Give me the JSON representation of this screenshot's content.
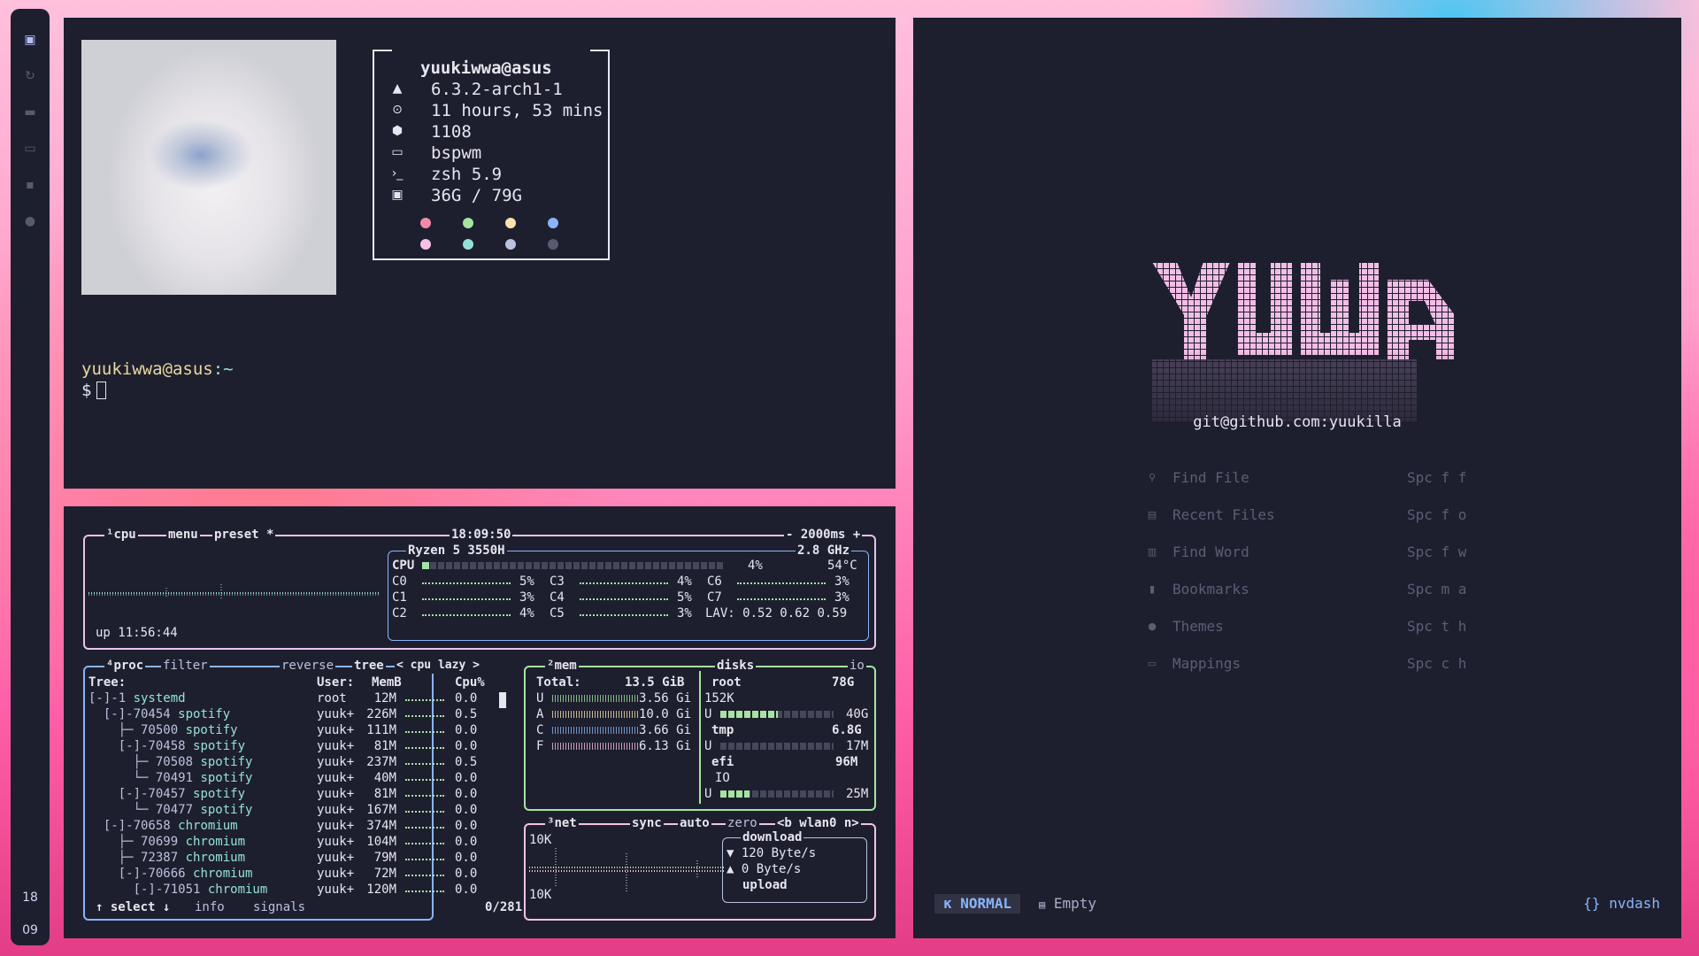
{
  "sidebar": {
    "workspaces": [
      "terminal-icon",
      "refresh-icon",
      "folder-icon",
      "window-icon",
      "chat-icon",
      "music-icon"
    ],
    "clock_hour": "18",
    "clock_minute": "09"
  },
  "neofetch": {
    "header": "yuukiwwa@asus",
    "items": [
      {
        "icon": "arch-icon",
        "glyph": "▲",
        "value": "6.3.2-arch1-1"
      },
      {
        "icon": "uptime-icon",
        "glyph": "⊙",
        "value": "11 hours, 53 mins"
      },
      {
        "icon": "package-icon",
        "glyph": "⬢",
        "value": "1108"
      },
      {
        "icon": "wm-icon",
        "glyph": "▭",
        "value": "bspwm"
      },
      {
        "icon": "shell-icon",
        "glyph": "›_",
        "value": "zsh 5.9"
      },
      {
        "icon": "disk-icon",
        "glyph": "▣",
        "value": "36G / 79G"
      }
    ],
    "colors_row1": [
      "#f38ba8",
      "#a6e3a1",
      "#f9e2af",
      "#89b4fa"
    ],
    "colors_row2": [
      "#f5c2e7",
      "#94e2d5",
      "#bac2de",
      "#585b70"
    ],
    "prompt_user": "yuukiwwa@asus",
    "prompt_path": ":~",
    "prompt_symbol": "$"
  },
  "btop": {
    "cpu": {
      "title": "cpu",
      "menu": "menu",
      "preset": "preset *",
      "clock": "18:09:50",
      "interval": "2000ms",
      "model": "Ryzen 5 3550H",
      "freq": "2.8 GHz",
      "total_label": "CPU",
      "total_pct": "4%",
      "temp": "54°C",
      "uptime": "up 11:56:44",
      "cores": [
        {
          "name": "C0",
          "pct": "5%"
        },
        {
          "name": "C1",
          "pct": "3%"
        },
        {
          "name": "C2",
          "pct": "4%"
        },
        {
          "name": "C3",
          "pct": "4%"
        },
        {
          "name": "C4",
          "pct": "5%"
        },
        {
          "name": "C5",
          "pct": "3%"
        },
        {
          "name": "C6",
          "pct": "3%"
        },
        {
          "name": "C7",
          "pct": "3%"
        }
      ],
      "lav_label": "LAV:",
      "lav": "0.52 0.62 0.59"
    },
    "proc": {
      "title": "proc",
      "filter": "filter",
      "reverse": "reverse",
      "tree": "tree",
      "sort": "< cpu lazy >",
      "headers": {
        "tree": "Tree:",
        "user": "User:",
        "mem": "MemB",
        "cpu": "Cpu%"
      },
      "rows": [
        {
          "prefix": "[-]-1 ",
          "name": "systemd",
          "user": "root",
          "mem": "12M",
          "cpu": "0.0"
        },
        {
          "prefix": "  [-]-70454 ",
          "name": "spotify",
          "user": "yuuk+",
          "mem": "226M",
          "cpu": "0.5"
        },
        {
          "prefix": "    ├─ 70500 ",
          "name": "spotify",
          "user": "yuuk+",
          "mem": "111M",
          "cpu": "0.0"
        },
        {
          "prefix": "    [-]-70458 ",
          "name": "spotify",
          "user": "yuuk+",
          "mem": "81M",
          "cpu": "0.0"
        },
        {
          "prefix": "      ├─ 70508 ",
          "name": "spotify",
          "user": "yuuk+",
          "mem": "237M",
          "cpu": "0.5"
        },
        {
          "prefix": "      └─ 70491 ",
          "name": "spotify",
          "user": "yuuk+",
          "mem": "40M",
          "cpu": "0.0"
        },
        {
          "prefix": "    [-]-70457 ",
          "name": "spotify",
          "user": "yuuk+",
          "mem": "81M",
          "cpu": "0.0"
        },
        {
          "prefix": "      └─ 70477 ",
          "name": "spotify",
          "user": "yuuk+",
          "mem": "167M",
          "cpu": "0.0"
        },
        {
          "prefix": "  [-]-70658 ",
          "name": "chromium",
          "user": "yuuk+",
          "mem": "374M",
          "cpu": "0.0"
        },
        {
          "prefix": "    ├─ 70699 ",
          "name": "chromium",
          "user": "yuuk+",
          "mem": "104M",
          "cpu": "0.0"
        },
        {
          "prefix": "    ├─ 72387 ",
          "name": "chromium",
          "user": "yuuk+",
          "mem": "79M",
          "cpu": "0.0"
        },
        {
          "prefix": "    [-]-70666 ",
          "name": "chromium",
          "user": "yuuk+",
          "mem": "72M",
          "cpu": "0.0"
        },
        {
          "prefix": "      [-]-71051 ",
          "name": "chromium",
          "user": "yuuk+",
          "mem": "120M",
          "cpu": "0.0"
        }
      ],
      "footer_select": "select",
      "footer_info": "info",
      "footer_signals": "signals",
      "count": "0/281"
    },
    "mem": {
      "title": "mem",
      "total_label": "Total:",
      "total": "13.5 GiB",
      "rows": [
        {
          "label": "U",
          "value": "3.56 Gi"
        },
        {
          "label": "A",
          "value": "10.0 Gi"
        },
        {
          "label": "C",
          "value": "3.66 Gi"
        },
        {
          "label": "F",
          "value": "6.13 Gi"
        }
      ]
    },
    "disks": {
      "title": "disks",
      "io": "io",
      "root_label": "root",
      "root_size": "78G",
      "root_io": "152K",
      "root_used_label": "U",
      "root_used": "40G",
      "tmp_label": "tmp",
      "tmp_size": "6.8G",
      "tmp_used_label": "U",
      "tmp_used": "17M",
      "efi_label": "efi",
      "efi_size": "96M",
      "efi_io_label": "IO",
      "efi_used_label": "U",
      "efi_used": "25M",
      "root_used_fraction": 0.51,
      "efi_used_fraction": 0.26
    },
    "net": {
      "title": "net",
      "sync": "sync",
      "auto": "auto",
      "zero": "zero",
      "iface": "<b wlan0 n>",
      "scale_top": "10K",
      "scale_bottom": "10K",
      "download_label": "download",
      "download_rate": "120 Byte/s",
      "upload_rate": "0 Byte/s",
      "upload_label": "upload"
    }
  },
  "nvim": {
    "logo": "YUWA",
    "subtitle": "git@github.com:yuukilla",
    "entries": [
      {
        "icon": "search-icon",
        "glyph": "⚲",
        "label": "Find File",
        "key": "Spc f f"
      },
      {
        "icon": "file-icon",
        "glyph": "▤",
        "label": "Recent Files",
        "key": "Spc f o"
      },
      {
        "icon": "word-icon",
        "glyph": "▥",
        "label": "Find Word",
        "key": "Spc f w"
      },
      {
        "icon": "bookmark-icon",
        "glyph": "▮",
        "label": "Bookmarks",
        "key": "Spc m a"
      },
      {
        "icon": "palette-icon",
        "glyph": "●",
        "label": "Themes",
        "key": "Spc t h"
      },
      {
        "icon": "keyboard-icon",
        "glyph": "▭",
        "label": "Mappings",
        "key": "Spc c h"
      }
    ],
    "mode": "NORMAL",
    "buffer": "Empty",
    "filetype": "nvdash"
  }
}
